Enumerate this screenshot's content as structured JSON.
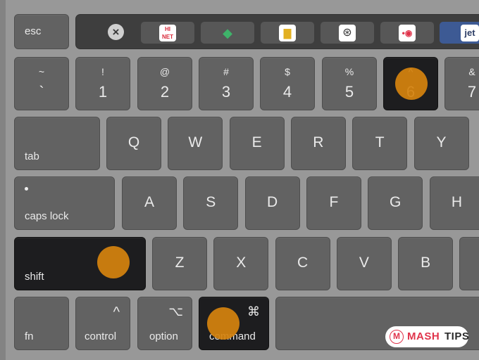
{
  "touchbar": {
    "esc_label": "esc",
    "close_icon": "×",
    "apps": [
      {
        "name": "hi-net-app",
        "glyph": "HI NET",
        "color": "#d92a3a"
      },
      {
        "name": "leaf-app",
        "glyph": "◆",
        "color": "#3fb36a"
      },
      {
        "name": "coffee-app",
        "glyph": "☕",
        "color": "#e2b021"
      },
      {
        "name": "spiral-app",
        "glyph": "⊛",
        "color": "#333333"
      },
      {
        "name": "record-app",
        "glyph": "•◉",
        "color": "#e0344b"
      },
      {
        "name": "jet-app",
        "glyph": "jet",
        "color": "#2d3e66"
      }
    ]
  },
  "number_row": [
    {
      "top": "~",
      "low": "`"
    },
    {
      "top": "!",
      "low": "1"
    },
    {
      "top": "@",
      "low": "2"
    },
    {
      "top": "#",
      "low": "3"
    },
    {
      "top": "$",
      "low": "4"
    },
    {
      "top": "%",
      "low": "5"
    },
    {
      "top": "^",
      "low": "6",
      "highlighted": true
    },
    {
      "top": "&",
      "low": "7"
    }
  ],
  "qwerty_row": {
    "tab_label": "tab",
    "letters": [
      "Q",
      "W",
      "E",
      "R",
      "T",
      "Y"
    ]
  },
  "home_row": {
    "caps_label": "caps lock",
    "letters": [
      "A",
      "S",
      "D",
      "F",
      "G",
      "H"
    ]
  },
  "bottom_letter_row": {
    "shift_label": "shift",
    "shift_highlighted": true,
    "letters": [
      "Z",
      "X",
      "C",
      "V",
      "B"
    ]
  },
  "modifier_row": {
    "fn_label": "fn",
    "control_label": "control",
    "control_symbol": "^",
    "option_label": "option",
    "option_symbol": "⌥",
    "command_label": "command",
    "command_symbol": "⌘",
    "command_highlighted": true
  },
  "highlight_color": "#d4820e",
  "watermark": {
    "mash": "MASH",
    "tips": "TIPS",
    "logo": "M"
  }
}
